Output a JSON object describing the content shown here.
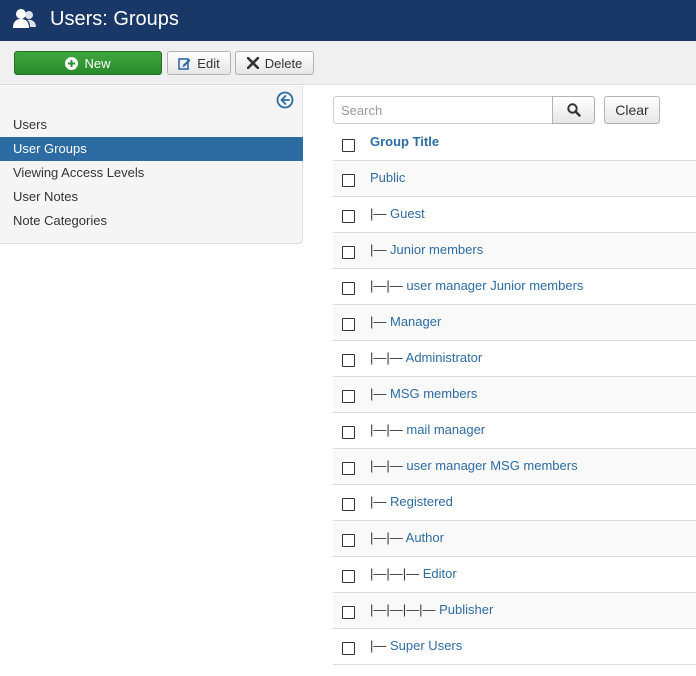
{
  "header": {
    "title": "Users: Groups",
    "icon": "users-icon"
  },
  "toolbar": {
    "new_label": "New",
    "edit_label": "Edit",
    "delete_label": "Delete"
  },
  "sidebar": {
    "items": [
      {
        "label": "Users",
        "active": false
      },
      {
        "label": "User Groups",
        "active": true
      },
      {
        "label": "Viewing Access Levels",
        "active": false
      },
      {
        "label": "User Notes",
        "active": false
      },
      {
        "label": "Note Categories",
        "active": false
      }
    ]
  },
  "search": {
    "placeholder": "Search",
    "value": "",
    "clear_label": "Clear"
  },
  "table": {
    "header": "Group Title",
    "rows": [
      {
        "prefix": "",
        "name": "Public"
      },
      {
        "prefix": "|— ",
        "name": "Guest"
      },
      {
        "prefix": "|— ",
        "name": "Junior members"
      },
      {
        "prefix": "|—|— ",
        "name": "user manager Junior members"
      },
      {
        "prefix": "|— ",
        "name": "Manager"
      },
      {
        "prefix": "|—|— ",
        "name": "Administrator"
      },
      {
        "prefix": "|— ",
        "name": "MSG members"
      },
      {
        "prefix": "|—|— ",
        "name": "mail manager"
      },
      {
        "prefix": "|—|— ",
        "name": "user manager MSG members"
      },
      {
        "prefix": "|— ",
        "name": "Registered"
      },
      {
        "prefix": "|—|— ",
        "name": "Author"
      },
      {
        "prefix": "|—|—|— ",
        "name": "Editor"
      },
      {
        "prefix": "|—|—|—|— ",
        "name": "Publisher"
      },
      {
        "prefix": "|— ",
        "name": "Super Users"
      }
    ]
  },
  "colors": {
    "header_bg": "#1a3867",
    "accent": "#2d6ca2",
    "new_button": "#2f8f2f"
  }
}
